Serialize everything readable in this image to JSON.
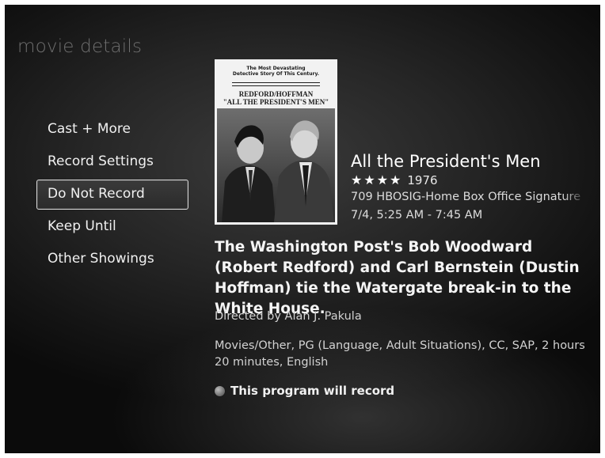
{
  "page": {
    "title": "movie details"
  },
  "menu": {
    "items": [
      {
        "label": "Cast + More"
      },
      {
        "label": "Record Settings"
      },
      {
        "label": "Do Not Record"
      },
      {
        "label": "Keep Until"
      },
      {
        "label": "Other Showings"
      }
    ],
    "selected": "Do Not Record"
  },
  "poster": {
    "tagline_line1": "The Most Devastating",
    "tagline_line2": "Detective Story Of This Century.",
    "title_line1": "REDFORD/HOFFMAN",
    "title_line2": "\"ALL THE PRESIDENT'S MEN\""
  },
  "movie": {
    "title": "All the President's Men",
    "stars": "★★★★",
    "year": "1976",
    "channel": "709 HBOSIG-Home Box Office Signature",
    "airtime": "7/4, 5:25 AM - 7:45 AM",
    "description": "The Washington Post's Bob Woodward (Robert Redford) and Carl Bernstein (Dustin Hoffman) tie the Watergate break-in to the White House.",
    "director": "Directed by Alan J. Pakula",
    "details": "Movies/Other, PG (Language, Adult Situations), CC, SAP, 2 hours 20 minutes, English"
  },
  "status": {
    "text": "This program will record",
    "icon": "record-indicator-icon"
  }
}
